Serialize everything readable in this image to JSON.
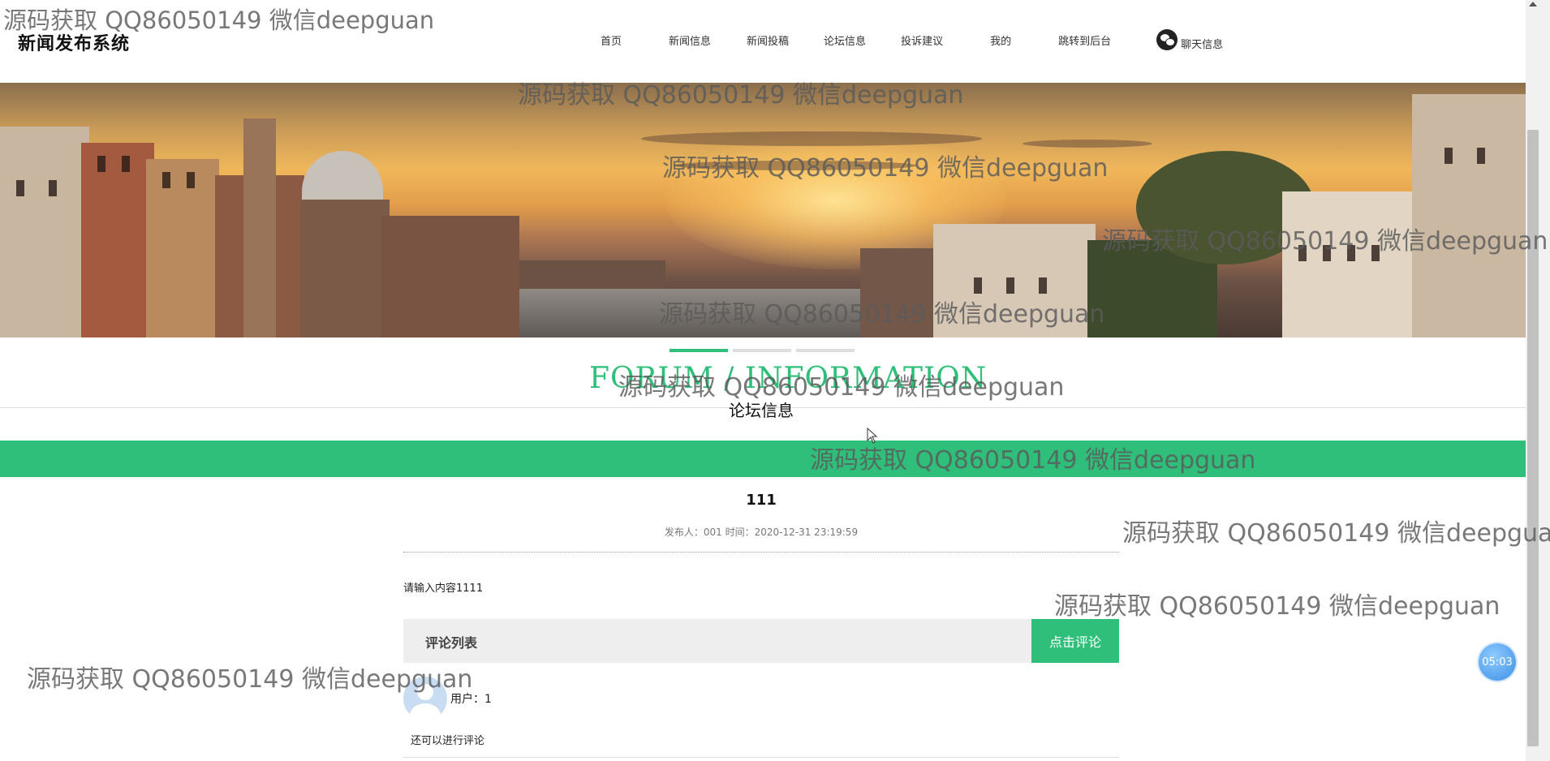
{
  "header": {
    "logo": "新闻发布系统",
    "nav": [
      {
        "label": "首页"
      },
      {
        "label": "新闻信息"
      },
      {
        "label": "新闻投稿"
      },
      {
        "label": "论坛信息"
      },
      {
        "label": "投诉建议"
      },
      {
        "label": "我的"
      },
      {
        "label": "跳转到后台"
      }
    ],
    "chat_label": "聊天信息",
    "chat_icon": "wechat-icon"
  },
  "section": {
    "title_en": "FORUM / INFORMATION",
    "title_cn": "论坛信息"
  },
  "slider": {
    "count": 3,
    "active_index": 0
  },
  "article": {
    "title": "111",
    "meta": "发布人：001 时间：2020-12-31 23:19:59",
    "content": "请输入内容1111"
  },
  "comments": {
    "header": "评论列表",
    "button_label": "点击评论",
    "items": [
      {
        "user": "用户：1",
        "text": "还可以进行评论"
      }
    ]
  },
  "timer": "05:03",
  "watermark": "源码获取 QQ86050149 微信deepguan",
  "colors": {
    "accent": "#2fbf7a",
    "header_bg": "#ffffff",
    "timer_bg": "#3d8fe6"
  }
}
